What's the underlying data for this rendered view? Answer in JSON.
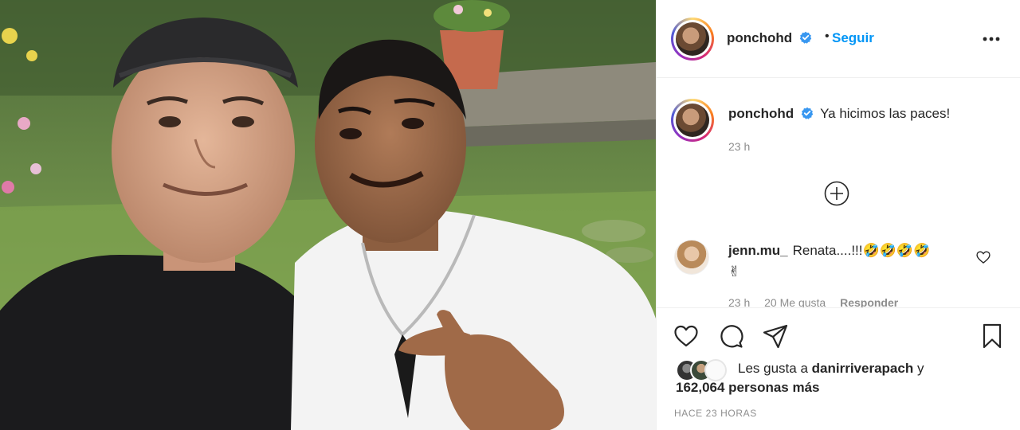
{
  "post": {
    "username": "ponchohd",
    "follow_label": "Seguir",
    "separator": "•",
    "caption": "Ya hicimos las paces!",
    "caption_time": "23 h",
    "timestamp": "HACE 23 HORAS"
  },
  "comment": {
    "username": "jenn.mu_",
    "text": "Renata....!!!",
    "emojis_line1": "🤣🤣🤣🤣",
    "emojis_line2": "✌",
    "time": "23 h",
    "likes": "20 Me gusta",
    "reply_label": "Responder"
  },
  "likes": {
    "prefix": "Les gusta a",
    "first_liker": "danirriverapach",
    "connector": "y",
    "others": "162,064 personas más"
  },
  "colors": {
    "accent": "#0095f6",
    "text": "#262626",
    "muted": "#8e8e8e",
    "border": "#efefef"
  },
  "icons": [
    "verified-badge-icon",
    "more-options-icon",
    "load-more-comments-icon",
    "heart-icon",
    "comment-icon",
    "share-icon",
    "save-icon"
  ]
}
